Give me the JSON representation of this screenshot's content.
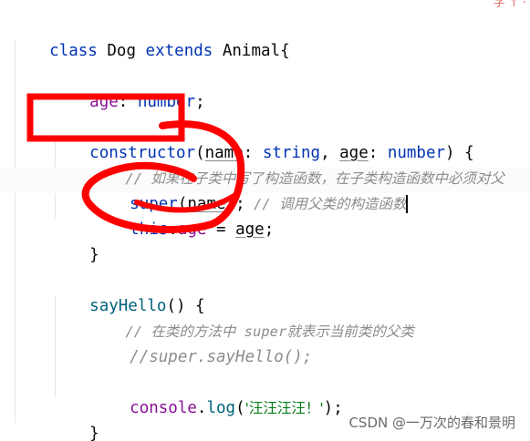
{
  "editor": {
    "corner_fragment": "字 ↑ ·",
    "lines": {
      "l1": {
        "kw": "class",
        "name": "Dog",
        "kw2": "extends",
        "parent": "Animal{"
      },
      "l2": {
        "prop": "age",
        "colon": ": ",
        "type": "number",
        "end": ";"
      },
      "l3": {
        "kw": "constructor",
        "open": "(",
        "p1": "name",
        "c1": ": ",
        "t1": "string",
        "comma": ", ",
        "p2": "age",
        "c2": ": ",
        "t2": "number",
        "close": ") {"
      },
      "l4": {
        "comment": "// 如果在子类中写了构造函数，在子类构造函数中必须对父"
      },
      "l5": {
        "kw": "super",
        "open": "(",
        "arg": "name",
        "close": ");",
        "comment": " // 调用父类的构造函数"
      },
      "l6": {
        "kw": "this",
        "dot": ".",
        "prop": "age",
        "eq": " = ",
        "val": "age",
        "end": ";"
      },
      "l7": {
        "brace": "}"
      },
      "l8": {
        "fn": "sayHello",
        "rest": "() {"
      },
      "l9": {
        "comment": "// 在类的方法中 super就表示当前类的父类"
      },
      "l10": {
        "comment": "//super.sayHello();"
      },
      "l11": {
        "obj": "console",
        "dot": ".",
        "fn": "log",
        "open": "(",
        "str": "'汪汪汪汪！'",
        "close": ");"
      },
      "l12": {
        "brace": "}"
      }
    }
  },
  "watermark": "CSDN @一万次的春和景明",
  "annotation_color": "#ff0000"
}
